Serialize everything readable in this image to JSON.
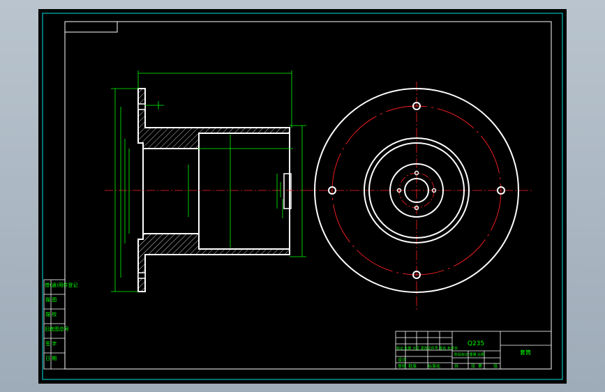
{
  "drawing": {
    "material": "Q235",
    "part_name": "套筒",
    "colors": {
      "background": "#000000",
      "frame": "#00e5e5",
      "outline": "#ffffff",
      "dimension": "#00ff00",
      "centerline": "#ff2020",
      "hatch": "#ffffff"
    }
  },
  "side_stamp": {
    "rows": [
      "借(通)用件登记",
      "描 图",
      "描 校",
      "旧底图总号",
      "签 字",
      "日 期"
    ]
  },
  "title_block": {
    "row1": "标记 处数 分区 更改文件号 签名 年月日",
    "design": "设计",
    "stage_labels": "阶段标记 重量 比例",
    "audit": "审核",
    "approve": "批准",
    "sheet_marks": [
      "共",
      "张",
      "第",
      "张"
    ],
    "std": "标准化"
  }
}
